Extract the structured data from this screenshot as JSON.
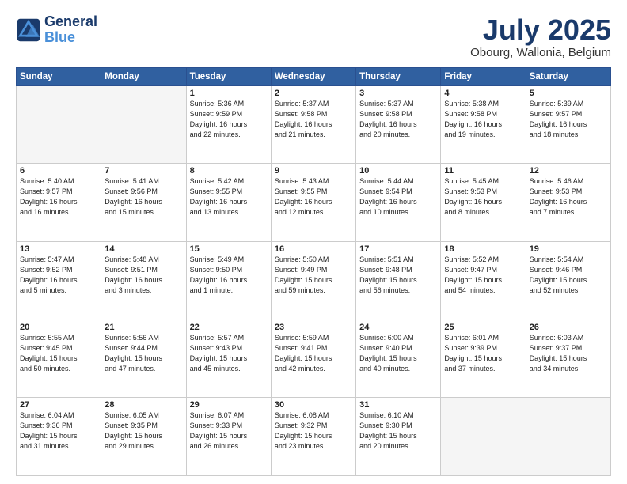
{
  "header": {
    "logo_line1": "General",
    "logo_line2": "Blue",
    "title": "July 2025",
    "subtitle": "Obourg, Wallonia, Belgium"
  },
  "weekdays": [
    "Sunday",
    "Monday",
    "Tuesday",
    "Wednesday",
    "Thursday",
    "Friday",
    "Saturday"
  ],
  "weeks": [
    [
      {
        "day": "",
        "info": ""
      },
      {
        "day": "",
        "info": ""
      },
      {
        "day": "1",
        "info": "Sunrise: 5:36 AM\nSunset: 9:59 PM\nDaylight: 16 hours\nand 22 minutes."
      },
      {
        "day": "2",
        "info": "Sunrise: 5:37 AM\nSunset: 9:58 PM\nDaylight: 16 hours\nand 21 minutes."
      },
      {
        "day": "3",
        "info": "Sunrise: 5:37 AM\nSunset: 9:58 PM\nDaylight: 16 hours\nand 20 minutes."
      },
      {
        "day": "4",
        "info": "Sunrise: 5:38 AM\nSunset: 9:58 PM\nDaylight: 16 hours\nand 19 minutes."
      },
      {
        "day": "5",
        "info": "Sunrise: 5:39 AM\nSunset: 9:57 PM\nDaylight: 16 hours\nand 18 minutes."
      }
    ],
    [
      {
        "day": "6",
        "info": "Sunrise: 5:40 AM\nSunset: 9:57 PM\nDaylight: 16 hours\nand 16 minutes."
      },
      {
        "day": "7",
        "info": "Sunrise: 5:41 AM\nSunset: 9:56 PM\nDaylight: 16 hours\nand 15 minutes."
      },
      {
        "day": "8",
        "info": "Sunrise: 5:42 AM\nSunset: 9:55 PM\nDaylight: 16 hours\nand 13 minutes."
      },
      {
        "day": "9",
        "info": "Sunrise: 5:43 AM\nSunset: 9:55 PM\nDaylight: 16 hours\nand 12 minutes."
      },
      {
        "day": "10",
        "info": "Sunrise: 5:44 AM\nSunset: 9:54 PM\nDaylight: 16 hours\nand 10 minutes."
      },
      {
        "day": "11",
        "info": "Sunrise: 5:45 AM\nSunset: 9:53 PM\nDaylight: 16 hours\nand 8 minutes."
      },
      {
        "day": "12",
        "info": "Sunrise: 5:46 AM\nSunset: 9:53 PM\nDaylight: 16 hours\nand 7 minutes."
      }
    ],
    [
      {
        "day": "13",
        "info": "Sunrise: 5:47 AM\nSunset: 9:52 PM\nDaylight: 16 hours\nand 5 minutes."
      },
      {
        "day": "14",
        "info": "Sunrise: 5:48 AM\nSunset: 9:51 PM\nDaylight: 16 hours\nand 3 minutes."
      },
      {
        "day": "15",
        "info": "Sunrise: 5:49 AM\nSunset: 9:50 PM\nDaylight: 16 hours\nand 1 minute."
      },
      {
        "day": "16",
        "info": "Sunrise: 5:50 AM\nSunset: 9:49 PM\nDaylight: 15 hours\nand 59 minutes."
      },
      {
        "day": "17",
        "info": "Sunrise: 5:51 AM\nSunset: 9:48 PM\nDaylight: 15 hours\nand 56 minutes."
      },
      {
        "day": "18",
        "info": "Sunrise: 5:52 AM\nSunset: 9:47 PM\nDaylight: 15 hours\nand 54 minutes."
      },
      {
        "day": "19",
        "info": "Sunrise: 5:54 AM\nSunset: 9:46 PM\nDaylight: 15 hours\nand 52 minutes."
      }
    ],
    [
      {
        "day": "20",
        "info": "Sunrise: 5:55 AM\nSunset: 9:45 PM\nDaylight: 15 hours\nand 50 minutes."
      },
      {
        "day": "21",
        "info": "Sunrise: 5:56 AM\nSunset: 9:44 PM\nDaylight: 15 hours\nand 47 minutes."
      },
      {
        "day": "22",
        "info": "Sunrise: 5:57 AM\nSunset: 9:43 PM\nDaylight: 15 hours\nand 45 minutes."
      },
      {
        "day": "23",
        "info": "Sunrise: 5:59 AM\nSunset: 9:41 PM\nDaylight: 15 hours\nand 42 minutes."
      },
      {
        "day": "24",
        "info": "Sunrise: 6:00 AM\nSunset: 9:40 PM\nDaylight: 15 hours\nand 40 minutes."
      },
      {
        "day": "25",
        "info": "Sunrise: 6:01 AM\nSunset: 9:39 PM\nDaylight: 15 hours\nand 37 minutes."
      },
      {
        "day": "26",
        "info": "Sunrise: 6:03 AM\nSunset: 9:37 PM\nDaylight: 15 hours\nand 34 minutes."
      }
    ],
    [
      {
        "day": "27",
        "info": "Sunrise: 6:04 AM\nSunset: 9:36 PM\nDaylight: 15 hours\nand 31 minutes."
      },
      {
        "day": "28",
        "info": "Sunrise: 6:05 AM\nSunset: 9:35 PM\nDaylight: 15 hours\nand 29 minutes."
      },
      {
        "day": "29",
        "info": "Sunrise: 6:07 AM\nSunset: 9:33 PM\nDaylight: 15 hours\nand 26 minutes."
      },
      {
        "day": "30",
        "info": "Sunrise: 6:08 AM\nSunset: 9:32 PM\nDaylight: 15 hours\nand 23 minutes."
      },
      {
        "day": "31",
        "info": "Sunrise: 6:10 AM\nSunset: 9:30 PM\nDaylight: 15 hours\nand 20 minutes."
      },
      {
        "day": "",
        "info": ""
      },
      {
        "day": "",
        "info": ""
      }
    ]
  ]
}
